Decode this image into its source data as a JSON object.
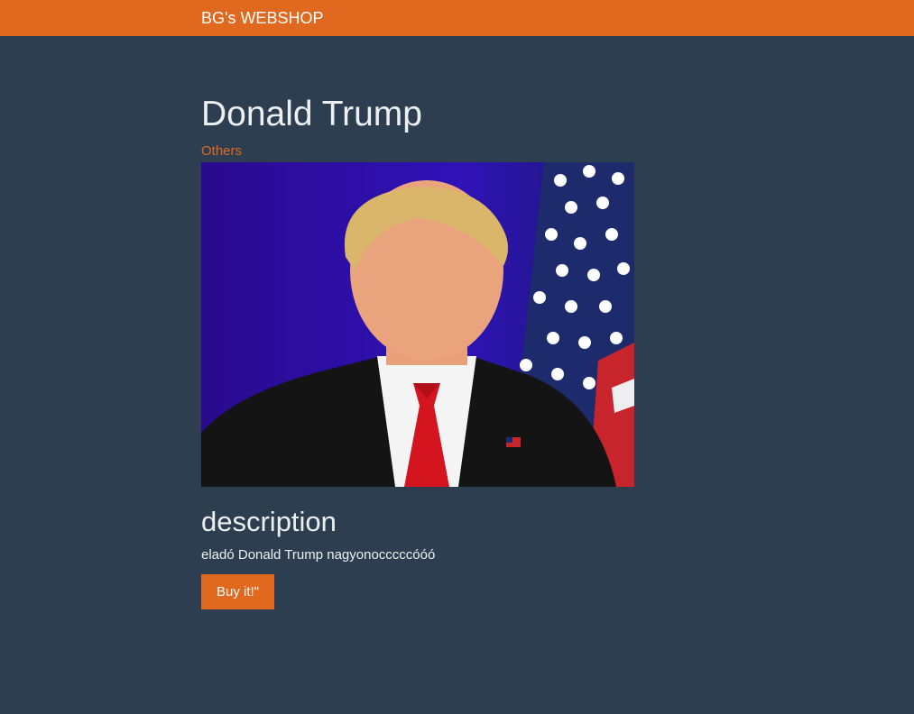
{
  "navbar": {
    "brand": "BG's WEBSHOP"
  },
  "product": {
    "title": "Donald Trump",
    "category": "Others",
    "image_description": "product photo: person in dark suit and red tie in front of a blue backdrop and a US flag",
    "description_heading": "description",
    "description": "eladó Donald Trump nagyonocccccóóó",
    "buy_label": "Buy it!\""
  },
  "colors": {
    "accent": "#e0691f",
    "background": "#2c3e50",
    "text": "#ecf0f1"
  }
}
